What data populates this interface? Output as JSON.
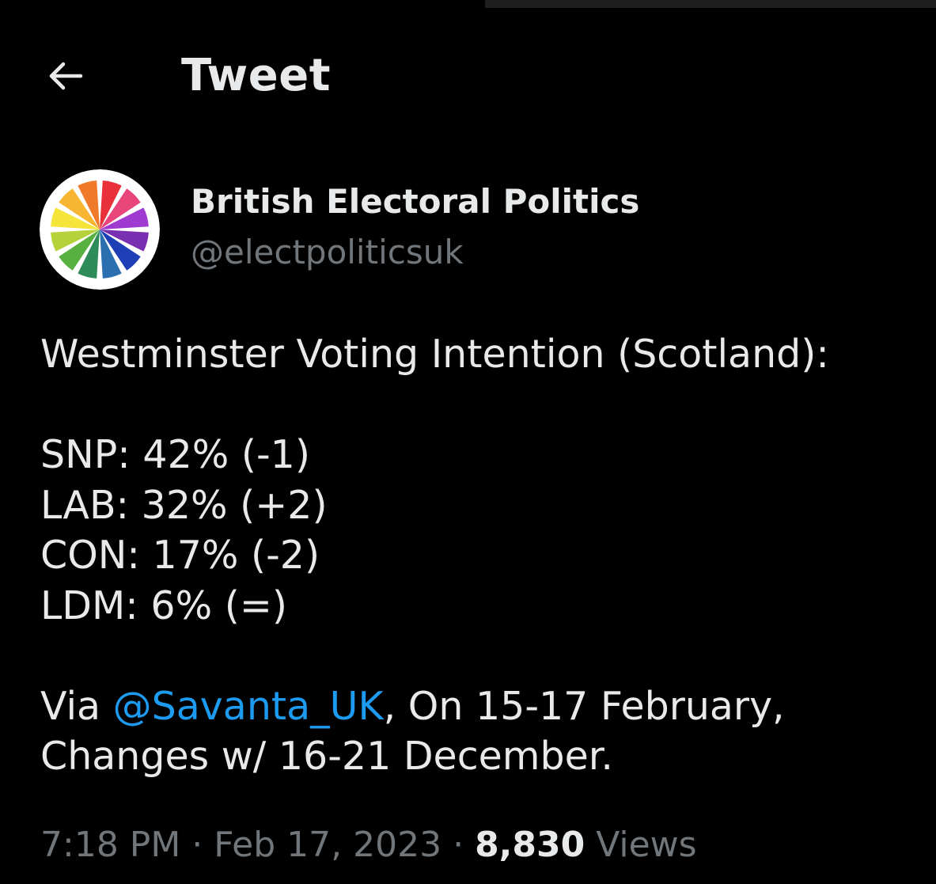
{
  "header": {
    "back_icon": "arrow-left-icon",
    "title": "Tweet"
  },
  "author": {
    "avatar_icon": "colored-pinwheel-logo",
    "display_name": "British Electoral Politics",
    "handle": "@electpoliticsuk"
  },
  "tweet": {
    "heading": "Westminster Voting Intention (Scotland):",
    "results": [
      "SNP: 42% (-1)",
      "LAB: 32% (+2)",
      "CON: 17% (-2)",
      "LDM: 6% (=)"
    ],
    "via_prefix": "Via ",
    "mention": "@Savanta_UK",
    "via_suffix": ", On 15-17 February,",
    "changes_line": "Changes w/ 16-21 December."
  },
  "meta": {
    "time": "7:18 PM",
    "separator": " · ",
    "date": "Feb 17, 2023",
    "views_count": "8,830",
    "views_label": " Views"
  },
  "colors": {
    "background": "#000000",
    "text": "#e7e9ea",
    "secondary_text": "#71767b",
    "link": "#1d9bf0"
  }
}
